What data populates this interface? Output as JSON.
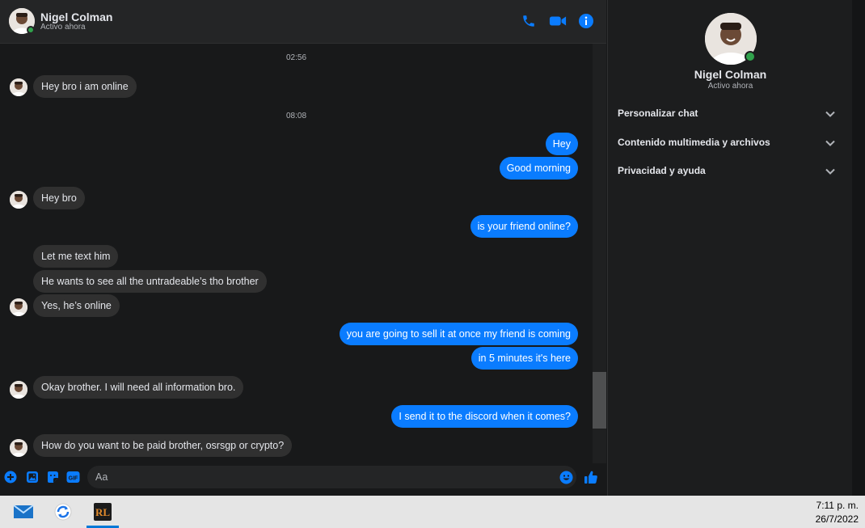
{
  "contact": {
    "name": "Nigel Colman",
    "status": "Activo ahora"
  },
  "header": {
    "icons": [
      "phone-icon",
      "video-camera-icon",
      "info-icon"
    ]
  },
  "timestamps": [
    "02:56",
    "08:08"
  ],
  "messages": [
    {
      "from": "them",
      "text": "Hey bro i am online"
    },
    {
      "from": "me",
      "text": "Hey"
    },
    {
      "from": "me",
      "text": "Good morning"
    },
    {
      "from": "them",
      "text": "Hey bro"
    },
    {
      "from": "me",
      "text": "is your friend online?"
    },
    {
      "from": "them",
      "text": "Let me text him"
    },
    {
      "from": "them",
      "text": "He wants to see all the untradeable’s tho brother"
    },
    {
      "from": "them",
      "text": "Yes, he’s online"
    },
    {
      "from": "me",
      "text": "you are going to sell it at once my friend is coming"
    },
    {
      "from": "me",
      "text": "in 5 minutes it's here"
    },
    {
      "from": "them",
      "text": "Okay brother. I will need all information bro."
    },
    {
      "from": "me",
      "text": "I send it to the discord when it comes?"
    },
    {
      "from": "them",
      "text": "How do you want to be paid brother, osrsgp or crypto?"
    }
  ],
  "composer": {
    "placeholder": "Aa",
    "icons": [
      "plus-circle-icon",
      "image-icon",
      "sticker-icon",
      "gif-icon",
      "emoji-icon",
      "thumbs-up-icon"
    ],
    "gif_label": "GIF"
  },
  "info_panel": {
    "name": "Nigel Colman",
    "status": "Activo ahora",
    "sections": [
      {
        "label": "Personalizar chat"
      },
      {
        "label": "Contenido multimedia y archivos"
      },
      {
        "label": "Privacidad y ayuda"
      }
    ]
  },
  "taskbar": {
    "apps": [
      "mail-icon",
      "sync-app-icon",
      "runelite-icon"
    ],
    "rl_label": "RL",
    "time": "7:11 p. m.",
    "date": "26/7/2022"
  },
  "colors": {
    "accent": "#0a7cff",
    "incoming_bubble": "#303030",
    "background": "#18191a",
    "online": "#31a24c"
  }
}
